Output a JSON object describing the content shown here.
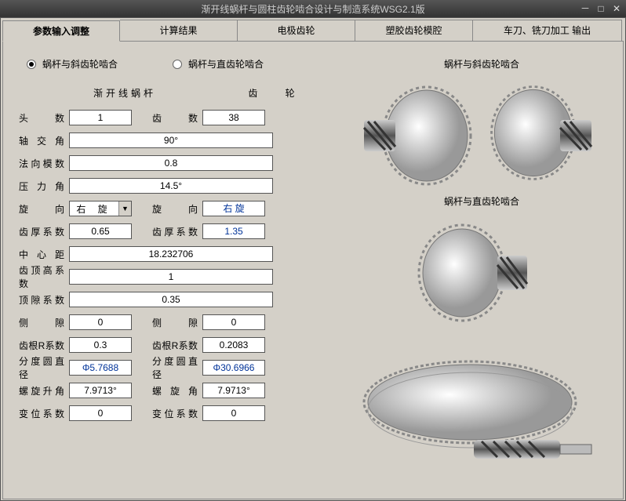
{
  "window": {
    "title": "渐开线蜗杆与圆柱齿轮啮合设计与制造系统WSG2.1版"
  },
  "tabs": {
    "t1": "参数输入调整",
    "t2": "计算结果",
    "t3": "电极齿轮",
    "t4": "塑胶齿轮模腔",
    "t5": "车刀、铣刀加工  输出"
  },
  "radios": {
    "r1": "蜗杆与斜齿轮啮合",
    "r2": "蜗杆与直齿轮啮合"
  },
  "columns": {
    "worm": "渐开线蜗杆",
    "gear": "齿    轮"
  },
  "labels": {
    "heads": "头  数",
    "teeth": "齿  数",
    "shaft_angle": "轴交角",
    "normal_module": "法向模数",
    "pressure_angle": "压力角",
    "rotation": "旋  向",
    "rotation2": "旋  向",
    "thick_coef": "齿厚系数",
    "thick_coef2": "齿厚系数",
    "center_dist": "中心距",
    "addendum_coef": "齿顶高系数",
    "clearance_coef": "顶隙系数",
    "backlash": "侧  隙",
    "backlash2": "侧  隙",
    "root_r": "齿根R系数",
    "root_r2": "齿根R系数",
    "pitch_dia": "分度圆直径",
    "pitch_dia2": "分度圆直径",
    "lead_angle": "螺旋升角",
    "helix_angle": "螺旋角",
    "shift_coef": "变位系数",
    "shift_coef2": "变位系数"
  },
  "values": {
    "heads": "1",
    "teeth": "38",
    "shaft_angle": "90°",
    "normal_module": "0.8",
    "pressure_angle": "14.5°",
    "rotation_sel": "右 旋",
    "rotation_gear": "右  旋",
    "thick_coef": "0.65",
    "thick_coef2": "1.35",
    "center_dist": "18.232706",
    "addendum_coef": "1",
    "clearance_coef": "0.35",
    "backlash": "0",
    "backlash2": "0",
    "root_r": "0.3",
    "root_r2": "0.2083",
    "pitch_dia": "Φ5.7688",
    "pitch_dia2": "Φ30.6966",
    "lead_angle": "7.9713°",
    "helix_angle": "7.9713°",
    "shift_coef": "0",
    "shift_coef2": "0"
  },
  "captions": {
    "c1": "蜗杆与斜齿轮啮合",
    "c2": "蜗杆与直齿轮啮合"
  }
}
